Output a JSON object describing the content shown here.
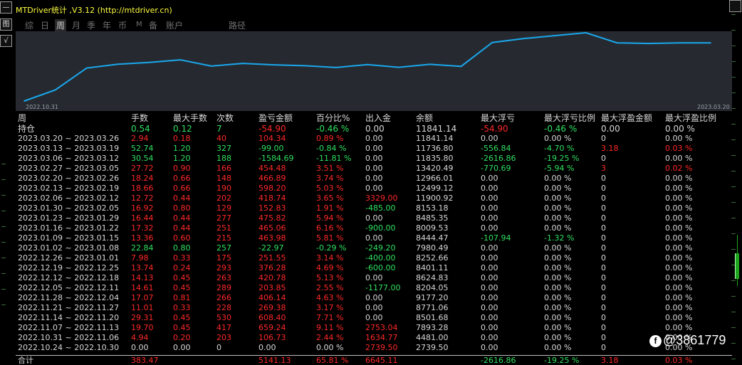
{
  "window": {
    "title": "MTDriver统计 ,V3.12 (http://mtdriver.cn)",
    "side_buttons": [
      "—",
      "图",
      "√"
    ]
  },
  "tabs": [
    {
      "label": "综",
      "active": false
    },
    {
      "label": "日",
      "active": false
    },
    {
      "label": "周",
      "active": true
    },
    {
      "label": "月",
      "active": false
    },
    {
      "label": "季",
      "active": false
    },
    {
      "label": "年",
      "active": false
    },
    {
      "label": "币",
      "active": false
    },
    {
      "label": "M",
      "active": false
    },
    {
      "label": "备",
      "active": false
    },
    {
      "label": "账户",
      "active": false
    },
    {
      "label": "路径",
      "active": false
    }
  ],
  "chart_data": {
    "type": "line",
    "x_start_label": "2022.10.31",
    "x_end_label": "2023.03.20",
    "x": [
      "2022.10.24",
      "2022.10.31",
      "2022.11.07",
      "2022.11.14",
      "2022.11.21",
      "2022.11.28",
      "2022.12.05",
      "2022.12.12",
      "2022.12.19",
      "2022.12.26",
      "2023.01.02",
      "2023.01.09",
      "2023.01.16",
      "2023.01.23",
      "2023.01.30",
      "2023.02.06",
      "2023.02.13",
      "2023.02.20",
      "2023.02.27",
      "2023.03.06",
      "2023.03.13",
      "2023.03.20",
      "2023.03.20h"
    ],
    "values": [
      2739.5,
      4481.0,
      7893.28,
      8501.68,
      8771.06,
      9177.2,
      8204.05,
      8624.83,
      8401.11,
      8252.66,
      7980.49,
      8444.47,
      8009.53,
      8485.35,
      8153.18,
      11900.92,
      12499.12,
      12966.01,
      13420.49,
      11835.8,
      11736.8,
      11841.14,
      11841.14
    ],
    "line_color": "#1aa7ec",
    "background": "#262a30"
  },
  "table": {
    "headers": [
      "周",
      "手数",
      "最大手数",
      "次数",
      "盈亏金额",
      "百分比%",
      "出入金",
      "余额",
      "最大浮亏",
      "最大浮亏比例",
      "最大浮盈金额",
      "最大浮盈比例"
    ],
    "holding": {
      "label": "持仓",
      "cells": [
        "0.54",
        "0.12",
        "7",
        "-54.90",
        "-0.46 %",
        "0.00",
        "11841.14",
        "-54.90",
        "-0.46 %",
        "0.00",
        "0.00 %"
      ],
      "colors": [
        "g",
        "g",
        "g",
        "r",
        "g",
        "w",
        "w",
        "r",
        "g",
        "w",
        "w"
      ]
    },
    "rows": [
      {
        "period": "2023.03.20 ~ 2023.03.26",
        "cells": [
          "2.94",
          "0.18",
          "40",
          "104.34",
          "0.89 %",
          "0.00",
          "11841.14",
          "0.00",
          "0.00 %",
          "0",
          "0.00 %"
        ],
        "colors": [
          "r",
          "r",
          "r",
          "r",
          "r",
          "w",
          "w",
          "w",
          "w",
          "w",
          "w"
        ]
      },
      {
        "period": "2023.03.13 ~ 2023.03.19",
        "cells": [
          "52.74",
          "1.20",
          "327",
          "-99.00",
          "-0.84 %",
          "0.00",
          "11736.80",
          "-556.84",
          "-4.70 %",
          "3.18",
          "0.03 %"
        ],
        "colors": [
          "g",
          "g",
          "g",
          "g",
          "g",
          "w",
          "w",
          "g",
          "g",
          "r",
          "r"
        ]
      },
      {
        "period": "2023.03.06 ~ 2023.03.12",
        "cells": [
          "30.54",
          "1.20",
          "188",
          "-1584.69",
          "-11.81 %",
          "0.00",
          "11835.80",
          "-2616.86",
          "-19.25 %",
          "0",
          "0.00 %"
        ],
        "colors": [
          "g",
          "g",
          "g",
          "g",
          "g",
          "w",
          "w",
          "g",
          "g",
          "w",
          "w"
        ]
      },
      {
        "period": "2023.02.27 ~ 2023.03.05",
        "cells": [
          "27.72",
          "0.90",
          "166",
          "454.48",
          "3.51 %",
          "0.00",
          "13420.49",
          "-770.69",
          "-5.94 %",
          "3",
          "0.02 %"
        ],
        "colors": [
          "r",
          "r",
          "r",
          "r",
          "r",
          "w",
          "w",
          "g",
          "g",
          "r",
          "r"
        ]
      },
      {
        "period": "2023.02.20 ~ 2023.02.26",
        "cells": [
          "18.24",
          "0.66",
          "148",
          "466.89",
          "3.74 %",
          "0.00",
          "12966.01",
          "0.00",
          "0.00 %",
          "0",
          "0.00 %"
        ],
        "colors": [
          "r",
          "r",
          "r",
          "r",
          "r",
          "w",
          "w",
          "w",
          "w",
          "w",
          "w"
        ]
      },
      {
        "period": "2023.02.13 ~ 2023.02.19",
        "cells": [
          "18.66",
          "0.66",
          "190",
          "598.20",
          "5.03 %",
          "0.00",
          "12499.12",
          "0.00",
          "0.00 %",
          "0",
          "0.00 %"
        ],
        "colors": [
          "r",
          "r",
          "r",
          "r",
          "r",
          "w",
          "w",
          "w",
          "w",
          "w",
          "w"
        ]
      },
      {
        "period": "2023.02.06 ~ 2023.02.12",
        "cells": [
          "12.72",
          "0.44",
          "202",
          "418.74",
          "3.65 %",
          "3329.00",
          "11900.92",
          "0.00",
          "0.00 %",
          "0",
          "0.00 %"
        ],
        "colors": [
          "r",
          "r",
          "r",
          "r",
          "r",
          "r",
          "w",
          "w",
          "w",
          "w",
          "w"
        ]
      },
      {
        "period": "2023.01.30 ~ 2023.02.05",
        "cells": [
          "16.92",
          "0.80",
          "129",
          "152.83",
          "1.91 %",
          "-485.00",
          "8153.18",
          "0.00",
          "0.00 %",
          "0",
          "0.00 %"
        ],
        "colors": [
          "r",
          "r",
          "r",
          "r",
          "r",
          "g",
          "w",
          "w",
          "w",
          "w",
          "w"
        ]
      },
      {
        "period": "2023.01.23 ~ 2023.01.29",
        "cells": [
          "16.44",
          "0.44",
          "277",
          "475.82",
          "5.94 %",
          "0.00",
          "8485.35",
          "0.00",
          "0.00 %",
          "0",
          "0.00 %"
        ],
        "colors": [
          "r",
          "r",
          "r",
          "r",
          "r",
          "w",
          "w",
          "w",
          "w",
          "w",
          "w"
        ]
      },
      {
        "period": "2023.01.16 ~ 2023.01.22",
        "cells": [
          "17.32",
          "0.44",
          "251",
          "465.06",
          "6.16 %",
          "-900.00",
          "8009.53",
          "0.00",
          "0.00 %",
          "0",
          "0.00 %"
        ],
        "colors": [
          "r",
          "r",
          "r",
          "r",
          "r",
          "g",
          "w",
          "w",
          "w",
          "w",
          "w"
        ]
      },
      {
        "period": "2023.01.09 ~ 2023.01.15",
        "cells": [
          "13.36",
          "0.60",
          "215",
          "463.98",
          "5.81 %",
          "0.00",
          "8444.47",
          "-107.94",
          "-1.32 %",
          "0",
          "0.00 %"
        ],
        "colors": [
          "r",
          "r",
          "r",
          "r",
          "r",
          "w",
          "w",
          "g",
          "g",
          "w",
          "w"
        ]
      },
      {
        "period": "2023.01.02 ~ 2023.01.08",
        "cells": [
          "22.84",
          "0.80",
          "257",
          "-22.97",
          "-0.29 %",
          "-249.20",
          "7980.49",
          "0.00",
          "0.00 %",
          "0",
          "0.00 %"
        ],
        "colors": [
          "g",
          "g",
          "g",
          "g",
          "g",
          "g",
          "w",
          "w",
          "w",
          "w",
          "w"
        ]
      },
      {
        "period": "2022.12.26 ~ 2023.01.01",
        "cells": [
          "7.98",
          "0.33",
          "175",
          "251.55",
          "3.14 %",
          "-400.00",
          "8252.66",
          "0.00",
          "0.00 %",
          "0",
          "0.00 %"
        ],
        "colors": [
          "r",
          "r",
          "r",
          "r",
          "r",
          "g",
          "w",
          "w",
          "w",
          "w",
          "w"
        ]
      },
      {
        "period": "2022.12.19 ~ 2022.12.25",
        "cells": [
          "13.74",
          "0.24",
          "293",
          "376.28",
          "4.69 %",
          "-600.00",
          "8401.11",
          "0.00",
          "0.00 %",
          "0",
          "0.00 %"
        ],
        "colors": [
          "r",
          "r",
          "r",
          "r",
          "r",
          "g",
          "w",
          "w",
          "w",
          "w",
          "w"
        ]
      },
      {
        "period": "2022.12.12 ~ 2022.12.18",
        "cells": [
          "14.13",
          "0.45",
          "263",
          "420.78",
          "5.13 %",
          "0.00",
          "8624.83",
          "0.00",
          "0.00 %",
          "0",
          "0.00 %"
        ],
        "colors": [
          "r",
          "r",
          "r",
          "r",
          "r",
          "w",
          "w",
          "w",
          "w",
          "w",
          "w"
        ]
      },
      {
        "period": "2022.12.05 ~ 2022.12.11",
        "cells": [
          "14.61",
          "0.45",
          "289",
          "203.85",
          "2.55 %",
          "-1177.00",
          "8204.05",
          "0.00",
          "0.00 %",
          "0",
          "0.00 %"
        ],
        "colors": [
          "r",
          "r",
          "r",
          "r",
          "r",
          "g",
          "w",
          "w",
          "w",
          "w",
          "w"
        ]
      },
      {
        "period": "2022.11.28 ~ 2022.12.04",
        "cells": [
          "17.07",
          "0.81",
          "266",
          "406.14",
          "4.63 %",
          "0.00",
          "9177.20",
          "0.00",
          "0.00 %",
          "0",
          "0.00 %"
        ],
        "colors": [
          "r",
          "r",
          "r",
          "r",
          "r",
          "w",
          "w",
          "w",
          "w",
          "w",
          "w"
        ]
      },
      {
        "period": "2022.11.21 ~ 2022.11.27",
        "cells": [
          "11.01",
          "0.33",
          "228",
          "269.38",
          "3.17 %",
          "0.00",
          "8771.06",
          "0.00",
          "0.00 %",
          "0",
          "0.00 %"
        ],
        "colors": [
          "r",
          "r",
          "r",
          "r",
          "r",
          "w",
          "w",
          "w",
          "w",
          "w",
          "w"
        ]
      },
      {
        "period": "2022.11.14 ~ 2022.11.20",
        "cells": [
          "29.31",
          "0.45",
          "530",
          "608.40",
          "7.71 %",
          "0.00",
          "8501.68",
          "0.00",
          "0.00 %",
          "0",
          "0.00 %"
        ],
        "colors": [
          "r",
          "r",
          "r",
          "r",
          "r",
          "w",
          "w",
          "w",
          "w",
          "w",
          "w"
        ]
      },
      {
        "period": "2022.11.07 ~ 2022.11.13",
        "cells": [
          "19.70",
          "0.45",
          "417",
          "659.24",
          "9.11 %",
          "2753.04",
          "7893.28",
          "0.00",
          "0.00 %",
          "0",
          "0.00 %"
        ],
        "colors": [
          "r",
          "r",
          "r",
          "r",
          "r",
          "r",
          "w",
          "w",
          "w",
          "w",
          "w"
        ]
      },
      {
        "period": "2022.10.31 ~ 2022.11.06",
        "cells": [
          "4.94",
          "0.20",
          "203",
          "106.73",
          "2.44 %",
          "1634.77",
          "4481.00",
          "0.00",
          "0.00 %",
          "0",
          "0.00 %"
        ],
        "colors": [
          "r",
          "r",
          "r",
          "r",
          "r",
          "r",
          "w",
          "w",
          "w",
          "w",
          "w"
        ]
      },
      {
        "period": "2022.10.24 ~ 2022.10.30",
        "cells": [
          "0.00",
          "0.00",
          "0",
          "0.00",
          "0.00 %",
          "2739.50",
          "2739.50",
          "0.00",
          "0.00 %",
          "0",
          "0.00 %"
        ],
        "colors": [
          "w",
          "w",
          "w",
          "w",
          "w",
          "r",
          "w",
          "w",
          "w",
          "w",
          "w"
        ]
      }
    ],
    "total": {
      "label": "合计",
      "cells": [
        "383.47",
        "",
        "",
        "5141.13",
        "65.81 %",
        "6645.11",
        "",
        "-2616.86",
        "-19.25 %",
        "3.18",
        "0.03 %"
      ],
      "colors": [
        "r",
        "w",
        "w",
        "r",
        "r",
        "r",
        "w",
        "g",
        "g",
        "r",
        "r"
      ]
    }
  },
  "watermark": {
    "text": "@3861779",
    "icon": "weibo-like-icon"
  },
  "colors": {
    "profit": "#ff2828",
    "loss": "#30e060",
    "neutral": "#d8d8d8",
    "title": "#ffff40",
    "chart_line": "#1aa7ec"
  }
}
